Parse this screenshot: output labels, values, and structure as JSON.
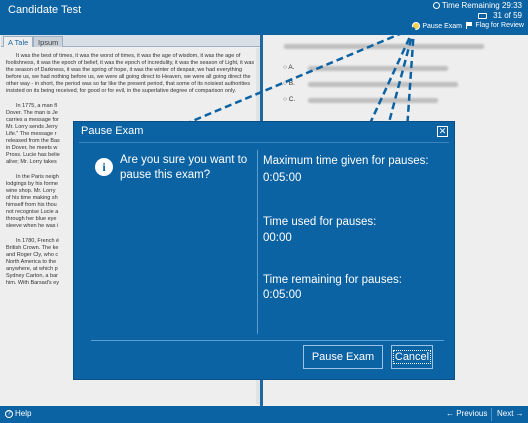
{
  "header": {
    "title": "Candidate Test",
    "time_remaining": "Time Remaining 29:33",
    "progress": "31 of 59"
  },
  "toolbar": {
    "pause_label": "Pause Exam",
    "flag_label": "Flag for Review"
  },
  "passage_tabs": [
    {
      "label": "A Tale",
      "active": true
    },
    {
      "label": "Ipsum",
      "active": false
    }
  ],
  "passage": {
    "p1": "It was the best of times, it was the worst of times, it was the age of wisdom, it was the age of foolishness, it was the epoch of belief, it was the epoch of incredulity, it was the season of Light, it was the season of Darkness, it was the spring of hope, it was the winter of despair, we had everything before us, we had nothing before us, we were all going direct to Heaven, we were all going direct the other way - in short, the period was so far like the present period, that some of its noisiest authorities insisted on its being received, for good or for evil, in the superlative degree of comparison only.",
    "p2_lines": [
      "In 1775, a man fl",
      "Dover. The man is Je",
      "carries a message for",
      "Mr. Lorry sends Jerry",
      "Life.\" The message r",
      "released from the Bas",
      "in Dover, he meets w",
      "Pross. Lucie has belie",
      "alive; Mr. Lorry takes"
    ],
    "p3_lines": [
      "In the Paris neigh",
      "lodgings by his forme",
      "wine shop. Mr. Lorry",
      "of his time making sh",
      "himself from his thou",
      "not recognise Lucie a",
      "through her blue eye",
      "sleeve when he was i"
    ],
    "p4_lines": [
      "In 1780, French é",
      "British Crown. The ke",
      "and Roger Cly, who c",
      "North America to the",
      "anywhere, at which p",
      "Sydney Carton, a bar",
      "him. With Barsad's ey"
    ]
  },
  "question": {
    "options": [
      "A.",
      "B.",
      "C."
    ]
  },
  "modal": {
    "title": "Pause Exam",
    "close_glyph": "✕",
    "question": "Are you sure you want to pause this exam?",
    "max_label": "Maximum time given for pauses:",
    "max_value": "0:05:00",
    "used_label": "Time used for pauses:",
    "used_value": "00:00",
    "remaining_label": "Time remaining for pauses:",
    "remaining_value": "0:05:00",
    "pause_button": "Pause Exam",
    "cancel_button": "Cancel"
  },
  "footer": {
    "help": "Help",
    "previous": "Previous",
    "next": "Next"
  },
  "colors": {
    "primary": "#0c63a4",
    "pause_dot": "#f2d04a"
  }
}
